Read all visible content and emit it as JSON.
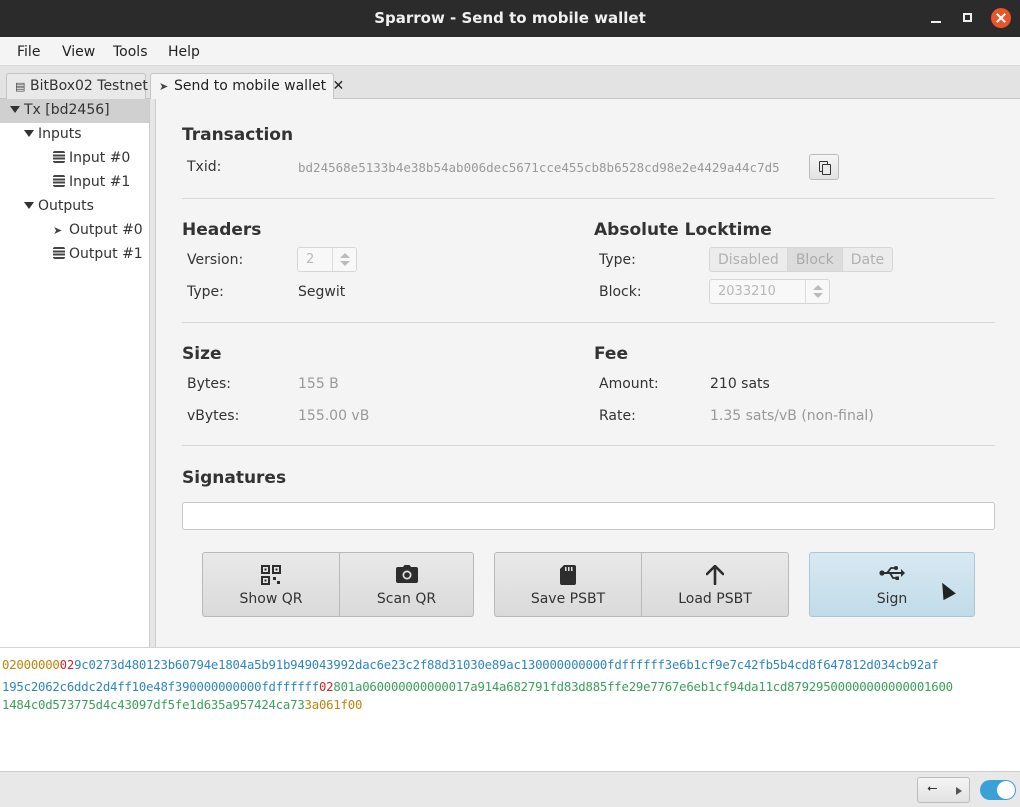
{
  "window": {
    "title": "Sparrow - Send to mobile wallet"
  },
  "menu": [
    "File",
    "View",
    "Tools",
    "Help"
  ],
  "tabs": [
    {
      "label": "BitBox02 Testnet",
      "icon": "wallet-icon"
    },
    {
      "label": "Send to mobile wallet",
      "icon": "send-icon",
      "close": "✕"
    }
  ],
  "tree": {
    "root": "Tx [bd2456]",
    "inputs_label": "Inputs",
    "inputs": [
      "Input #0",
      "Input #1"
    ],
    "outputs_label": "Outputs",
    "outputs": [
      "Output #0",
      "Output #1"
    ]
  },
  "transaction": {
    "title": "Transaction",
    "txid_label": "Txid:",
    "txid": "bd24568e5133b4e38b54ab006dec5671cce455cb8b6528cd98e2e4429a44c7d5"
  },
  "headers": {
    "title": "Headers",
    "version_label": "Version:",
    "version": "2",
    "type_label": "Type:",
    "type": "Segwit"
  },
  "locktime": {
    "title": "Absolute Locktime",
    "type_label": "Type:",
    "options": [
      "Disabled",
      "Block",
      "Date"
    ],
    "selected": "Block",
    "block_label": "Block:",
    "block": "2033210"
  },
  "size": {
    "title": "Size",
    "bytes_label": "Bytes:",
    "bytes": "155 B",
    "vbytes_label": "vBytes:",
    "vbytes": "155.00 vB"
  },
  "fee": {
    "title": "Fee",
    "amount_label": "Amount:",
    "amount": "210 sats",
    "rate_label": "Rate:",
    "rate": "1.35 sats/vB (non-final)"
  },
  "signatures": {
    "title": "Signatures"
  },
  "actions": {
    "show_qr": "Show QR",
    "scan_qr": "Scan QR",
    "save_psbt": "Save PSBT",
    "load_psbt": "Load PSBT",
    "sign": "Sign"
  },
  "hex": {
    "line1": [
      {
        "t": "02000000",
        "c": "#b8860b"
      },
      {
        "t": "02",
        "c": "#d0262d"
      },
      {
        "t": "9c0273d480123b60794e1804a5b91b949043992dac6e23c2f88d31030e89ac130000000000fdffffff3e6b1cf9e7c42fb5b4cd8f647812d034cb92af",
        "c": "#2e86c1"
      }
    ],
    "line2": [
      {
        "t": "195c2062c6ddc2d4ff10e48f390000000000fdffffff",
        "c": "#2e86c1"
      },
      {
        "t": "02",
        "c": "#d0262d"
      },
      {
        "t": "801a060000000000017a914a682791fd83d885ffe29e7767e6eb1cf94da11cd87929500000000000001600",
        "c": "#3aa05a"
      }
    ],
    "line3": [
      {
        "t": "1484c0d573775d4c43097df5fe1d635a957424ca73",
        "c": "#3aa05a"
      },
      {
        "t": "3a061f00",
        "c": "#b8860b"
      }
    ]
  },
  "colors": {
    "accent": "#3aa0d8",
    "titlebar": "#2b2b2b",
    "close": "#e9542a",
    "sign_button": "#c8deeb"
  }
}
